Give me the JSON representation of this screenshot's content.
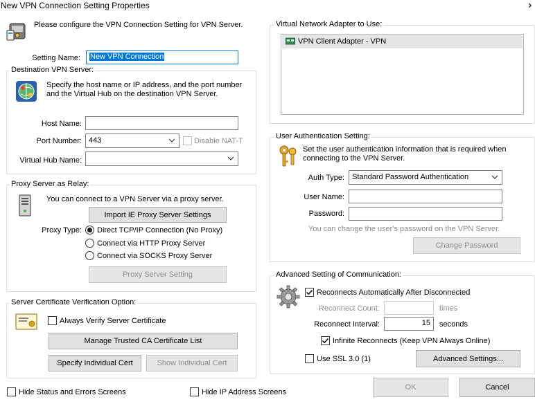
{
  "window": {
    "title": "New VPN Connection Setting Properties",
    "close_glyph": "›"
  },
  "intro": "Please configure the VPN Connection Setting for VPN Server.",
  "setting_name": {
    "label": "Setting Name:",
    "value": "New VPN Connection"
  },
  "destination": {
    "title": "Destination VPN Server:",
    "description": "Specify the host name or IP address, and the port number and the Virtual Hub on the destination VPN Server.",
    "host_label": "Host Name:",
    "host_value": "",
    "port_label": "Port Number:",
    "port_value": "443",
    "disable_nat_label": "Disable NAT-T",
    "hub_label": "Virtual Hub Name:",
    "hub_value": ""
  },
  "proxy": {
    "title": "Proxy Server as Relay:",
    "description": "You can connect to a VPN Server via a proxy server.",
    "import_button": "Import IE Proxy Server Settings",
    "type_label": "Proxy Type:",
    "options": [
      "Direct TCP/IP Connection (No Proxy)",
      "Connect via HTTP Proxy Server",
      "Connect via SOCKS Proxy Server"
    ],
    "selected_index": 0,
    "setting_button": "Proxy Server Setting"
  },
  "cert": {
    "title": "Server Certificate Verification Option:",
    "always_verify_label": "Always Verify Server Certificate",
    "manage_button": "Manage Trusted CA Certificate List",
    "specify_button": "Specify Individual Cert",
    "show_button": "Show Individual Cert"
  },
  "adapter": {
    "title": "Virtual Network Adapter to Use:",
    "items": [
      "VPN Client Adapter - VPN"
    ]
  },
  "auth": {
    "title": "User Authentication Setting:",
    "description": "Set the user authentication information that is required when connecting to the VPN Server.",
    "type_label": "Auth Type:",
    "type_value": "Standard Password Authentication",
    "user_label": "User Name:",
    "user_value": "",
    "password_label": "Password:",
    "password_value": "",
    "hint": "You can change the user's password on the VPN Server.",
    "change_button": "Change Password"
  },
  "advanced": {
    "title": "Advanced Setting of Communication:",
    "reconnect_label": "Reconnects Automatically After Disconnected",
    "count_label": "Reconnect Count:",
    "count_value": "",
    "count_unit": "times",
    "interval_label": "Reconnect Interval:",
    "interval_value": "15",
    "interval_unit": "seconds",
    "infinite_label": "Infinite Reconnects (Keep VPN Always Online)",
    "ssl_label": "Use SSL 3.0 (1)",
    "advanced_button": "Advanced Settings..."
  },
  "footer": {
    "hide_status_label": "Hide Status and Errors Screens",
    "hide_ip_label": "Hide IP Address Screens",
    "ok_button": "OK",
    "cancel_button": "Cancel"
  }
}
